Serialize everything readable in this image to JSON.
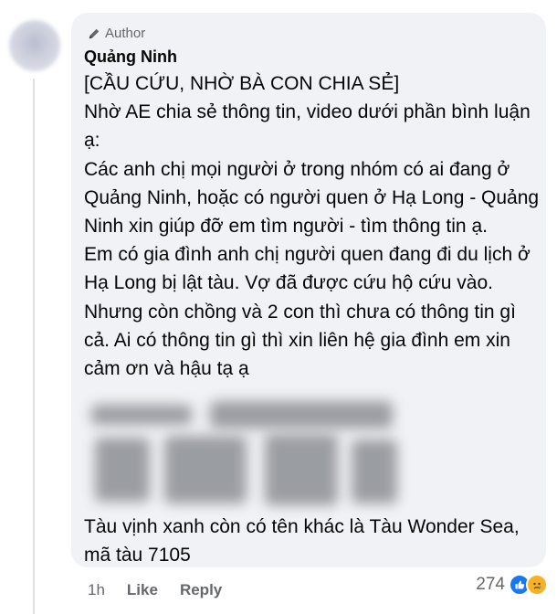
{
  "comment": {
    "author_badge": "Author",
    "author_name": "Quảng Ninh",
    "paragraphs": [
      "[CẦU CỨU, NHỜ BÀ CON CHIA SẺ]",
      "Nhờ AE chia sẻ thông tin, video dưới phần bình luận ạ:",
      "Các anh chị mọi người ở trong nhóm có ai đang ở Quảng Ninh, hoặc có người quen ở Hạ Long - Quảng Ninh xin giúp đỡ em tìm người - tìm thông tin ạ.",
      "Em có gia đình anh chị người quen đang đi du lịch ở Hạ Long bị lật tàu. Vợ đã được cứu hộ cứu vào. Nhưng còn chồng và 2 con thì chưa có thông tin gì cả. Ai có thông tin gì thì xin liên hệ gia đình em xin cảm ơn và hậu tạ ạ"
    ],
    "tail": "Tàu vịnh xanh còn có tên khác là Tàu Wonder Sea, mã tàu 7105"
  },
  "actions": {
    "time": "1h",
    "like": "Like",
    "reply": "Reply"
  },
  "reactions": {
    "count": "274",
    "icons": [
      "like-icon",
      "sad-icon"
    ]
  },
  "colors": {
    "bubble": "#f0f2f5",
    "secondary_text": "#65676b",
    "like_blue": "#1877f2",
    "sad_yellow": "#f7b125"
  }
}
